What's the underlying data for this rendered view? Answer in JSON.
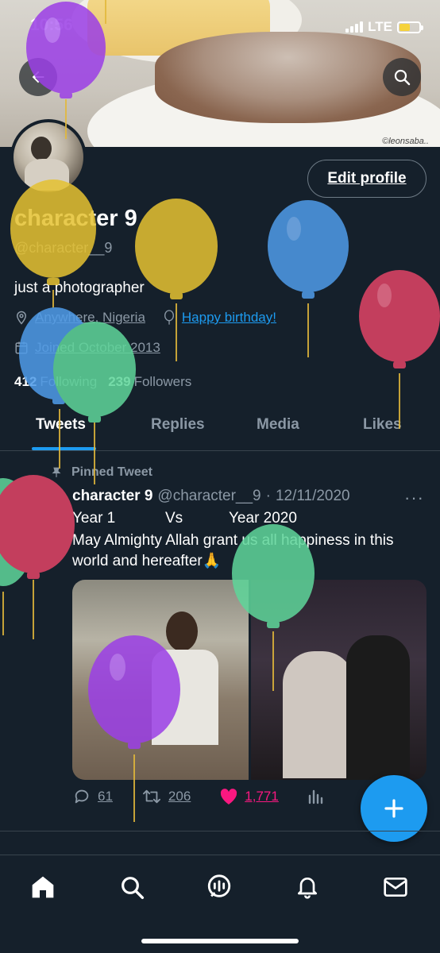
{
  "status_bar": {
    "time": "10:56",
    "network": "LTE"
  },
  "banner": {
    "watermark": "©leonsaba.."
  },
  "profile": {
    "name": "character 9",
    "handle": "@character__9",
    "bio": "just a photographer",
    "location": "Anywhere, Nigeria",
    "birthday": "Happy birthday!",
    "joined": "Joined October 2013",
    "following_count": "412",
    "following_label": "Following",
    "followers_count": "239",
    "followers_label": "Followers",
    "edit_button": "Edit profile"
  },
  "tabs": [
    "Tweets",
    "Replies",
    "Media",
    "Likes"
  ],
  "tweet": {
    "pinned_label": "Pinned Tweet",
    "author_name": "character 9",
    "author_handle": "@character__9",
    "dot": "·",
    "date": "12/11/2020",
    "line1_a": "Year 1",
    "line1_b": "Vs",
    "line1_c": "Year 2020",
    "body": "May Almighty Allah grant us all happiness in this world and hereafter🙏",
    "replies": "61",
    "retweets": "206",
    "likes": "1,771",
    "more_icon": "···"
  },
  "colors": {
    "background": "#15202b",
    "accent": "#1d9bf0",
    "like": "#f91880",
    "muted": "#8b98a5"
  },
  "icons": [
    "back-arrow-icon",
    "search-icon",
    "location-pin-icon",
    "balloon-icon",
    "calendar-icon",
    "pin-icon",
    "reply-icon",
    "retweet-icon",
    "heart-icon",
    "analytics-icon",
    "plus-icon",
    "home-icon",
    "explore-icon",
    "spaces-icon",
    "notifications-icon",
    "messages-icon"
  ]
}
